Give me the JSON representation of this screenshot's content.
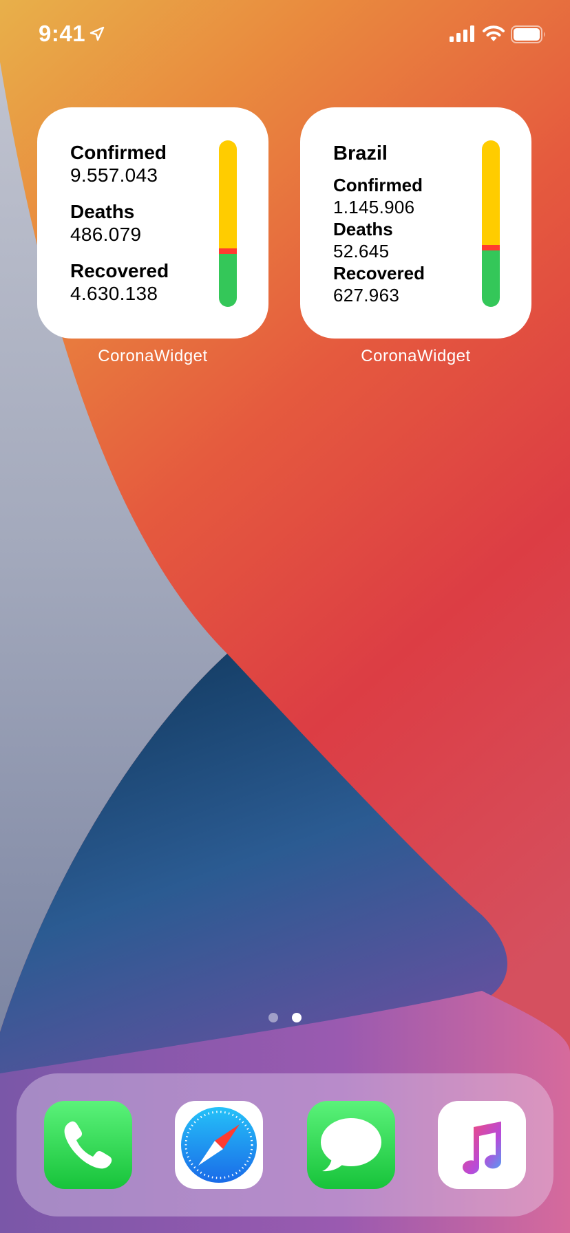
{
  "status_bar": {
    "time": "9:41",
    "icons": [
      "location-arrow-icon",
      "cellular-signal-icon",
      "wifi-icon",
      "battery-icon"
    ]
  },
  "widgets": [
    {
      "app_label": "CoronaWidget",
      "stats": [
        {
          "label": "Confirmed",
          "value": "9.557.043"
        },
        {
          "label": "Deaths",
          "value": "486.079"
        },
        {
          "label": "Recovered",
          "value": "4.630.138"
        }
      ],
      "bar_fractions": {
        "active": 0.65,
        "deaths": 0.03,
        "recovered": 0.32
      },
      "bar_colors": {
        "active": "#ffcc00",
        "deaths": "#ff3b30",
        "recovered": "#34c759"
      }
    },
    {
      "app_label": "CoronaWidget",
      "country": "Brazil",
      "stats": [
        {
          "label": "Confirmed",
          "value": "1.145.906"
        },
        {
          "label": "Deaths",
          "value": "52.645"
        },
        {
          "label": "Recovered",
          "value": "627.963"
        }
      ],
      "bar_fractions": {
        "active": 0.63,
        "deaths": 0.03,
        "recovered": 0.34
      },
      "bar_colors": {
        "active": "#ffcc00",
        "deaths": "#ff3b30",
        "recovered": "#34c759"
      }
    }
  ],
  "page_dots": {
    "count": 2,
    "active_index": 1
  },
  "dock": {
    "apps": [
      {
        "name": "Phone",
        "icon": "phone-icon"
      },
      {
        "name": "Safari",
        "icon": "safari-compass-icon"
      },
      {
        "name": "Messages",
        "icon": "messages-bubble-icon"
      },
      {
        "name": "Music",
        "icon": "music-note-icon"
      }
    ]
  }
}
